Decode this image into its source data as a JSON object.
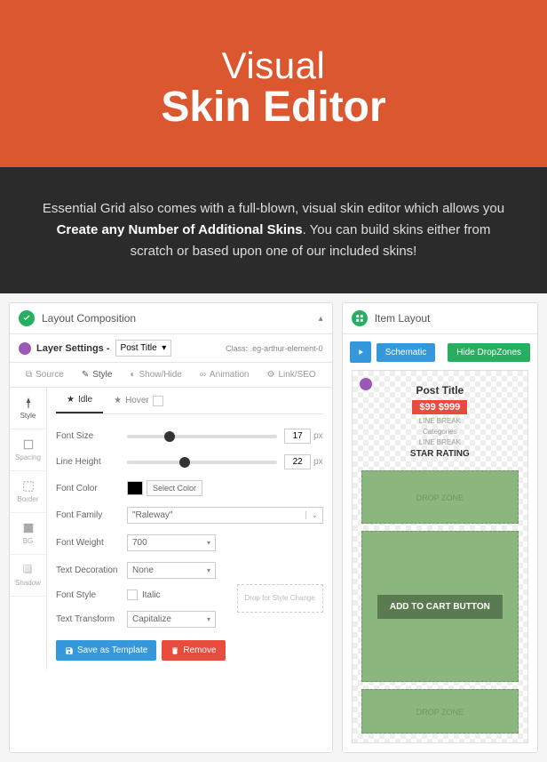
{
  "hero": {
    "line1": "Visual",
    "line2": "Skin Editor"
  },
  "desc": {
    "p1": "Essential Grid also comes with a full-blown, visual skin editor which allows you ",
    "strong": "Create any Number of Additional Skins",
    "p2": ". You can build skins either from scratch or based upon one of our included skins!"
  },
  "left": {
    "title": "Layout Composition",
    "layer": {
      "label": "Layer Settings -",
      "type": "Post Title",
      "class": "Class: .eg-arthur-element-0"
    },
    "tabs1": [
      "Source",
      "Style",
      "Show/Hide",
      "Animation",
      "Link/SEO"
    ],
    "sidebar": [
      {
        "label": "Style"
      },
      {
        "label": "Spacing"
      },
      {
        "label": "Border"
      },
      {
        "label": "BG"
      },
      {
        "label": "Shadow"
      }
    ],
    "tabs2": {
      "idle": "Idle",
      "hover": "Hover"
    },
    "form": {
      "fontSize": {
        "label": "Font Size",
        "value": "17",
        "unit": "px"
      },
      "lineHeight": {
        "label": "Line Height",
        "value": "22",
        "unit": "px"
      },
      "fontColor": {
        "label": "Font Color",
        "btn": "Select Color"
      },
      "fontFamily": {
        "label": "Font Family",
        "value": "\"Raleway\""
      },
      "fontWeight": {
        "label": "Font Weight",
        "value": "700"
      },
      "textDecoration": {
        "label": "Text Decoration",
        "value": "None"
      },
      "fontStyle": {
        "label": "Font Style",
        "value": "Italic"
      },
      "textTransform": {
        "label": "Text Transform",
        "value": "Capitalize"
      }
    },
    "dropHint": "Drop for Style Change",
    "saveBtn": "Save as Template",
    "removeBtn": "Remove"
  },
  "right": {
    "title": "Item Layout",
    "schematic": "Schematic",
    "hide": "Hide DropZones",
    "item": {
      "title": "Post Title",
      "price": "$99 $999",
      "lb": "LINE BREAK",
      "cat": "Categories",
      "star": "STAR RATING",
      "dz": "DROP ZONE",
      "cart": "ADD TO CART BUTTON"
    }
  }
}
